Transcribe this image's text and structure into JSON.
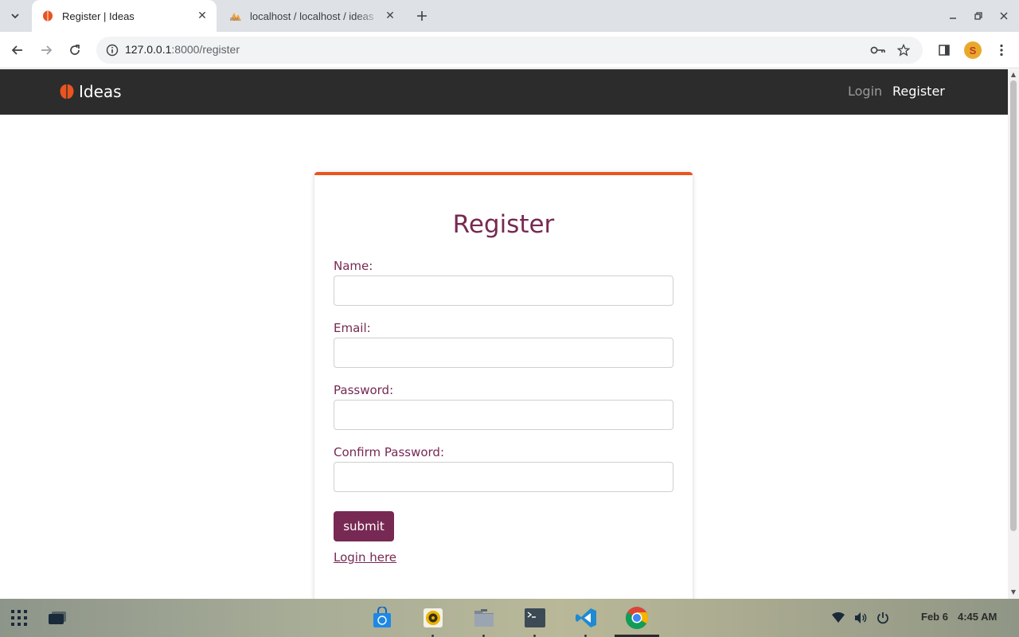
{
  "browser": {
    "tabs": [
      {
        "title": "Register | Ideas",
        "active": true
      },
      {
        "title": "localhost / localhost / ideas",
        "active": false
      }
    ],
    "url_host": "127.0.0.1",
    "url_rest": ":8000/register"
  },
  "page": {
    "brand": "Ideas",
    "nav": {
      "login": "Login",
      "register": "Register"
    },
    "form": {
      "title": "Register",
      "fields": [
        {
          "label": "Name:",
          "value": ""
        },
        {
          "label": "Email:",
          "value": ""
        },
        {
          "label": "Password:",
          "value": ""
        },
        {
          "label": "Confirm Password:",
          "value": ""
        }
      ],
      "submit": "submit",
      "login_link": "Login here"
    },
    "colors": {
      "accent": "#e95420",
      "primary": "#772953",
      "navbar": "#2c2c2c"
    }
  },
  "taskbar": {
    "apps": [
      "app-grid",
      "window-switcher",
      "store",
      "rhythmbox",
      "files",
      "terminal",
      "vscode",
      "chrome"
    ],
    "date": "Feb 6",
    "time": "4:45 AM"
  }
}
